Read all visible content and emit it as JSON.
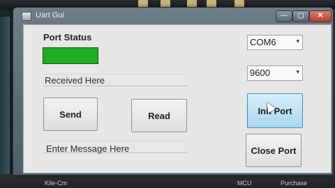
{
  "window": {
    "title": "Uart Gui",
    "controls": {
      "minimize": "—",
      "maximize": "▢",
      "close": "✕"
    }
  },
  "port_status": {
    "label": "Port Status",
    "indicator_color": "#1fae22"
  },
  "received": {
    "text": "Received Here"
  },
  "message": {
    "placeholder": "Enter Message Here"
  },
  "buttons": {
    "send": "Send",
    "read": "Read",
    "init_port": "Init Port",
    "close_port": "Close Port"
  },
  "port_select": {
    "value": "COM6",
    "arrow": "▾"
  },
  "baud_select": {
    "value": "9600",
    "arrow": "▾"
  },
  "taskbar": {
    "left_text": "Kile-Cm",
    "items": [
      "MCU",
      "Purchase"
    ]
  }
}
